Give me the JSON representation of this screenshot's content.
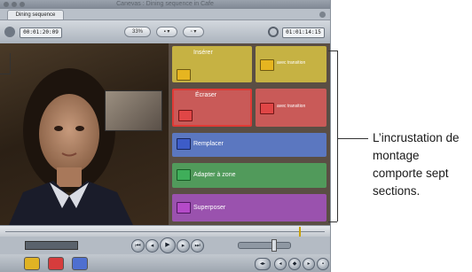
{
  "window": {
    "title": "Canevas : Dining sequence in Cafe",
    "tab_label": "Dining sequence"
  },
  "toolbar": {
    "timecode_left": "00:01:20:09",
    "zoom_label": "33%",
    "timecode_right": "01:01:14:15"
  },
  "overlay": {
    "sections": [
      {
        "label": "Insérer",
        "sub": "",
        "color": "#c9b13a",
        "icon_color": "#e0b324"
      },
      {
        "label": "",
        "sub": "avec transition",
        "color": "#c9b13a",
        "icon_color": "#e0b324"
      },
      {
        "label": "Écraser",
        "sub": "",
        "color": "#c85050",
        "icon_color": "#e04040"
      },
      {
        "label": "",
        "sub": "avec transition",
        "color": "#c85050",
        "icon_color": "#e04040"
      },
      {
        "label": "Remplacer",
        "sub": "",
        "color": "#5b78c4",
        "icon_color": "#3f62c8"
      },
      {
        "label": "Adapter à zone",
        "sub": "",
        "color": "#4f9a5c",
        "icon_color": "#3fae5a"
      },
      {
        "label": "Superposer",
        "sub": "",
        "color": "#9a4fb0",
        "icon_color": "#b048c4"
      }
    ]
  },
  "callout": {
    "text": "L’incrustation de montage comporte sept sections."
  },
  "icons": [
    "window-close-icon",
    "window-minimize-icon",
    "window-zoom-icon",
    "play-icon",
    "stop-icon",
    "next-edit-icon",
    "prev-edit-icon",
    "loop-icon"
  ]
}
